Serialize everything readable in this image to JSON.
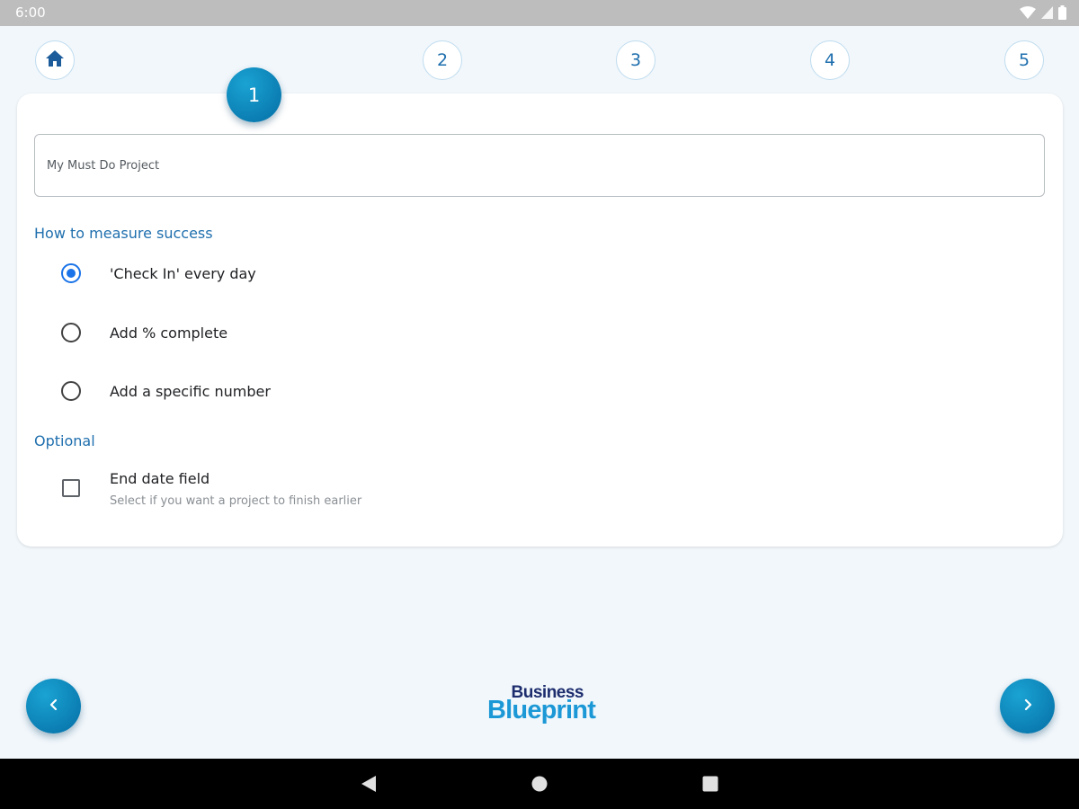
{
  "status_bar": {
    "time": "6:00",
    "icons": [
      "wifi-icon",
      "signal-icon",
      "battery-icon"
    ]
  },
  "steps": {
    "home_icon": "home-icon",
    "active": "1",
    "items": [
      "2",
      "3",
      "4",
      "5"
    ]
  },
  "form": {
    "project_name_value": "My Must Do Project",
    "measure_heading": "How to measure success",
    "measure_options": [
      {
        "label": "'Check In' every day",
        "checked": true
      },
      {
        "label": "Add % complete",
        "checked": false
      },
      {
        "label": "Add a specific number",
        "checked": false
      }
    ],
    "optional_heading": "Optional",
    "end_date": {
      "title": "End date field",
      "subtitle": "Select if you want a project to finish earlier",
      "checked": false
    }
  },
  "footer": {
    "back_icon": "chevron-left-icon",
    "next_icon": "chevron-right-icon",
    "logo_line1": "Business",
    "logo_line2": "Blueprint"
  },
  "system_nav": [
    "back-triangle-icon",
    "home-circle-icon",
    "recents-square-icon"
  ],
  "colors": {
    "accent": "#0a7bb0",
    "heading_blue": "#1f6fae",
    "radio_blue": "#1a73e8",
    "background": "#f1f7fb"
  }
}
